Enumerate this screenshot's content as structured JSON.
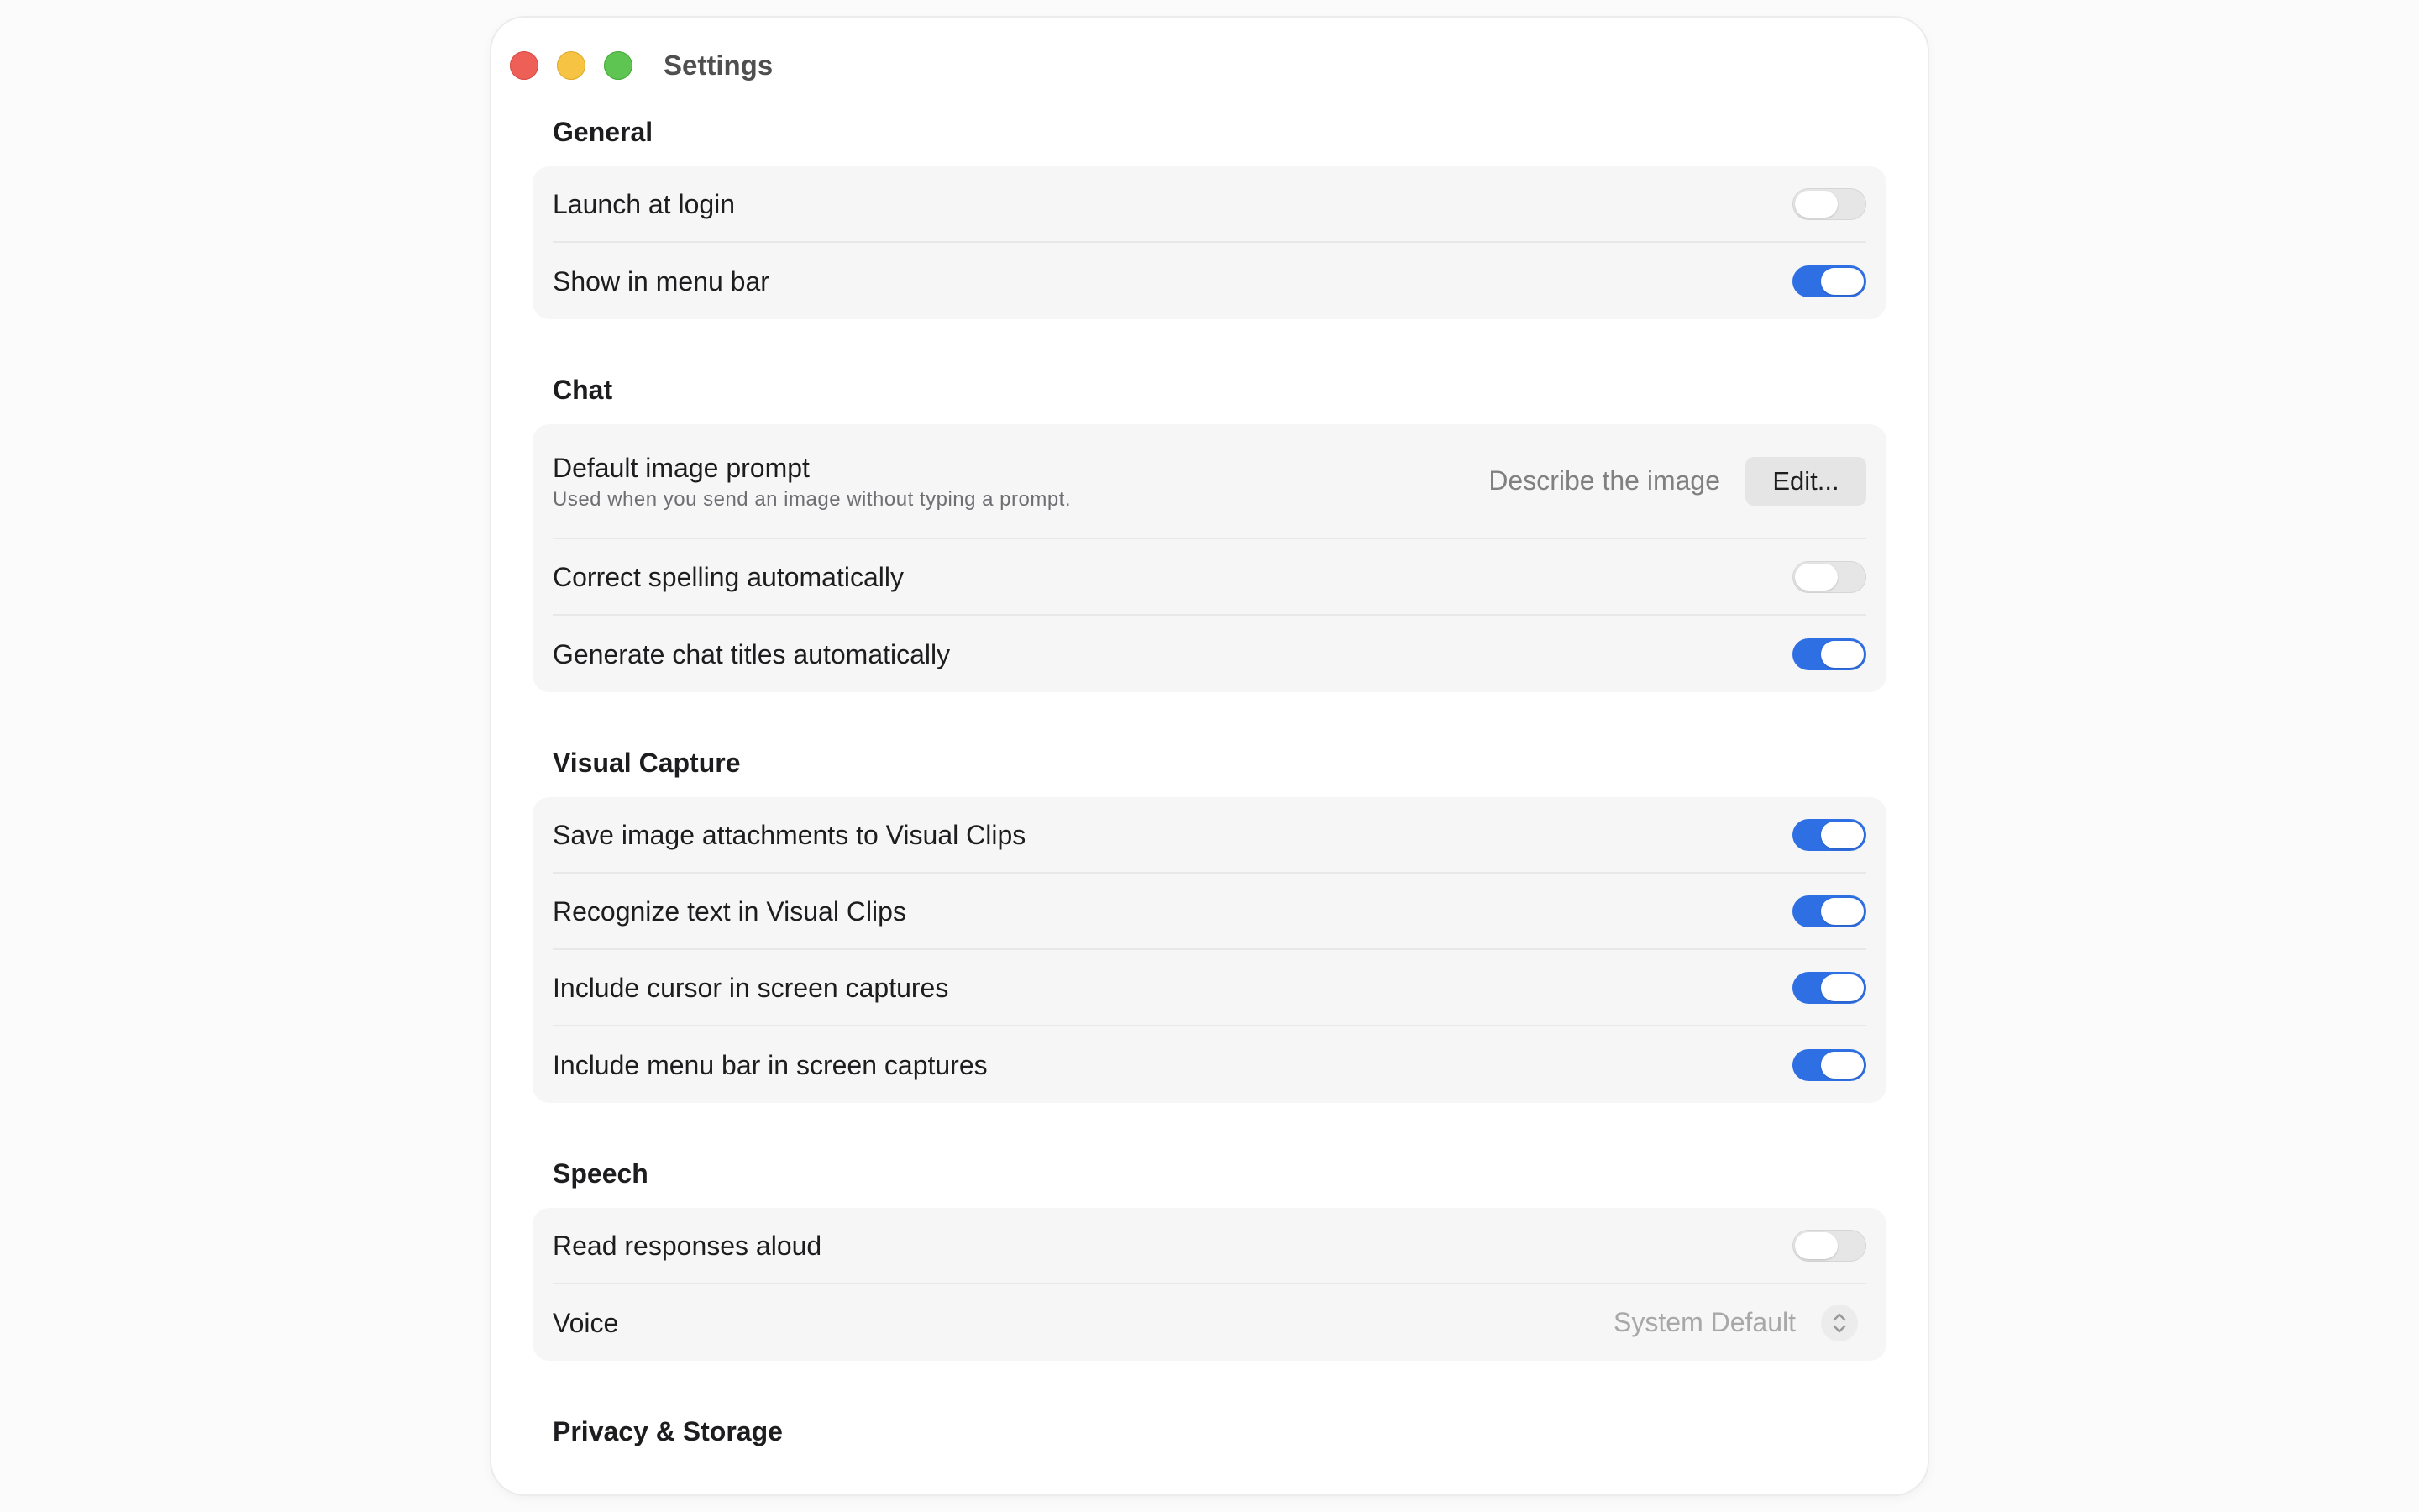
{
  "window": {
    "title": "Settings"
  },
  "sections": {
    "general": {
      "title": "General",
      "launch_at_login": {
        "label": "Launch at login",
        "toggle": "off"
      },
      "show_in_menu_bar": {
        "label": "Show in menu bar",
        "toggle": "on"
      }
    },
    "chat": {
      "title": "Chat",
      "default_image_prompt": {
        "label": "Default image prompt",
        "sublabel": "Used when you send an image without typing a prompt.",
        "value": "Describe the image",
        "button": "Edit..."
      },
      "correct_spelling": {
        "label": "Correct spelling automatically",
        "toggle": "off"
      },
      "generate_titles": {
        "label": "Generate chat titles automatically",
        "toggle": "on"
      }
    },
    "visual_capture": {
      "title": "Visual Capture",
      "save_attachments": {
        "label": "Save image attachments to Visual Clips",
        "toggle": "on"
      },
      "recognize_text": {
        "label": "Recognize text in Visual Clips",
        "toggle": "on"
      },
      "include_cursor": {
        "label": "Include cursor in screen captures",
        "toggle": "on"
      },
      "include_menu_bar": {
        "label": "Include menu bar in screen captures",
        "toggle": "on"
      }
    },
    "speech": {
      "title": "Speech",
      "read_aloud": {
        "label": "Read responses aloud",
        "toggle": "off"
      },
      "voice": {
        "label": "Voice",
        "value": "System Default",
        "icon": "chevron-up-down-icon"
      }
    },
    "privacy": {
      "title": "Privacy & Storage"
    }
  },
  "colors": {
    "toggle_on": "#2f6fe4",
    "toggle_off": "#e6e6e6",
    "close": "#ee5f58",
    "minimize": "#f6c343",
    "maximize": "#5ec452"
  }
}
